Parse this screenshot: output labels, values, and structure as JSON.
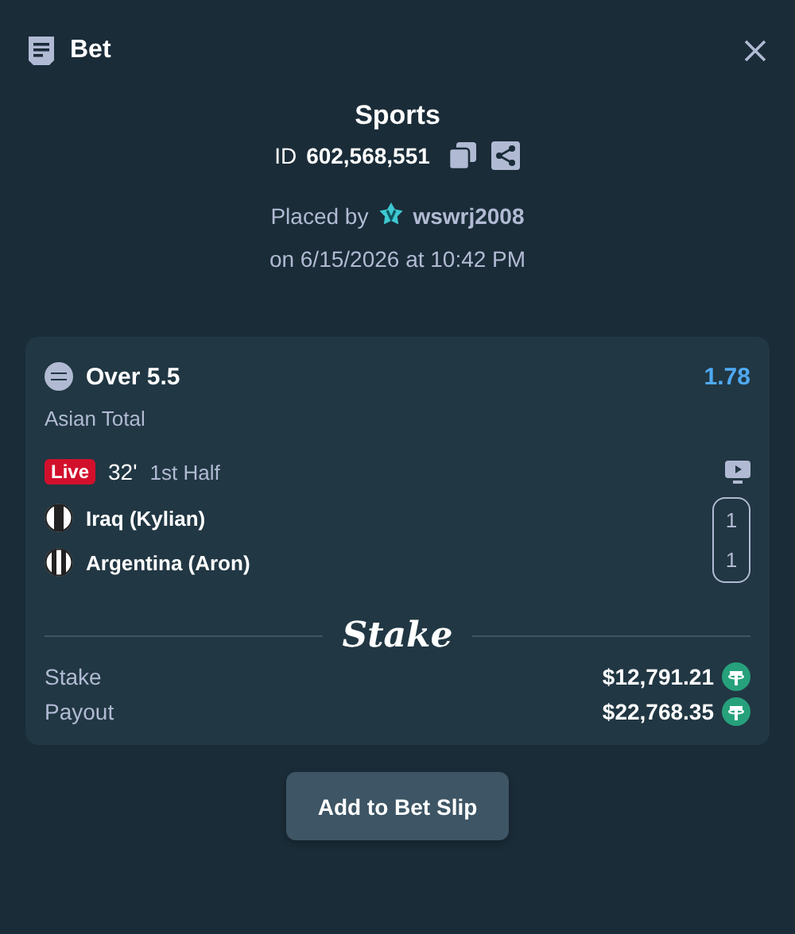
{
  "header": {
    "title": "Bet"
  },
  "summary": {
    "category": "Sports",
    "id_label": "ID",
    "id_value": "602,568,551",
    "placed_by": "Placed by",
    "user": "wswrj2008",
    "date": "on 6/15/2026 at 10:42 PM"
  },
  "bet": {
    "selection": "Over 5.5",
    "odds": "1.78",
    "market": "Asian Total",
    "live": true,
    "live_label": "Live",
    "minute": "32'",
    "period": "1st Half",
    "teams": [
      {
        "name": "Iraq (Kylian)",
        "score": "1"
      },
      {
        "name": "Argentina (Aron)",
        "score": "1"
      }
    ],
    "brand": "Stake",
    "amounts": [
      {
        "label": "Stake",
        "value": "$12,791.21"
      },
      {
        "label": "Payout",
        "value": "$22,768.35"
      }
    ]
  },
  "button": "Add to Bet Slip"
}
